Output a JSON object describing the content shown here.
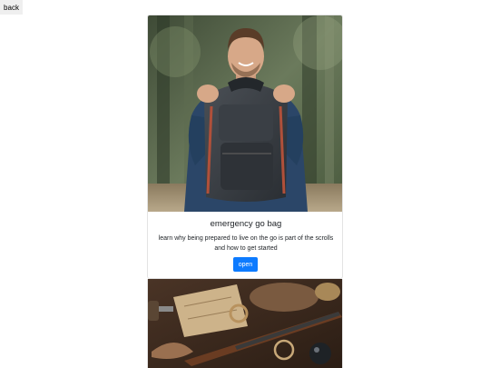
{
  "nav": {
    "back_label": "back"
  },
  "cards": [
    {
      "title": "emergency go bag",
      "description": "learn why being prepared to live on the go is part of the scrolls and how to get started",
      "button_label": "open",
      "image_subject": "man-holding-backpack"
    },
    {
      "image_subject": "rifle-and-survival-gear"
    }
  ],
  "colors": {
    "button_primary": "#0d7bff",
    "back_button_bg": "#efefef",
    "card_border": "#e3e3e3"
  }
}
